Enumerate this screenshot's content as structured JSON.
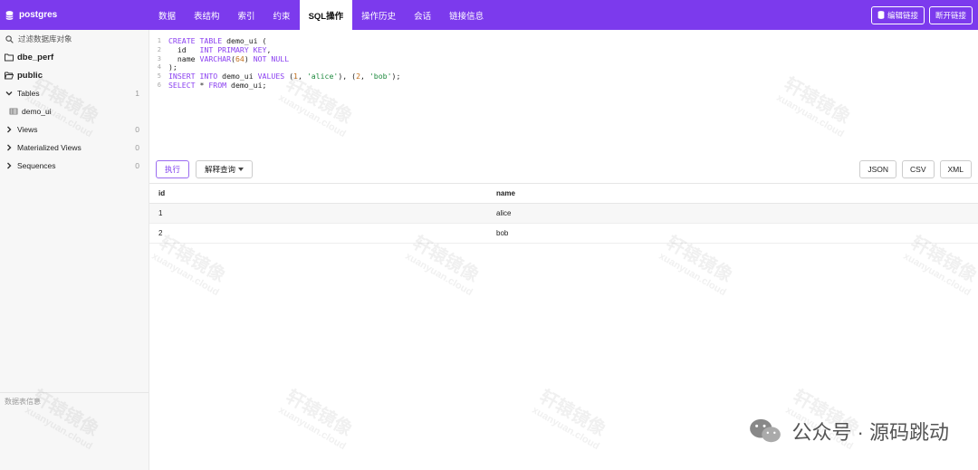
{
  "header": {
    "db_name": "postgres",
    "tabs": [
      "数据",
      "表结构",
      "索引",
      "约束",
      "SQL操作",
      "操作历史",
      "会话",
      "链接信息"
    ],
    "active_tab": "SQL操作",
    "edit_conn_label": "编辑链接",
    "disconnect_label": "断开链接"
  },
  "sidebar": {
    "search_placeholder": "过滤数据库对象",
    "db": "dbe_perf",
    "schema": "public",
    "tables_label": "Tables",
    "tables_count": "1",
    "table_item": "demo_ui",
    "views_label": "Views",
    "views_count": "0",
    "mviews_label": "Materialized Views",
    "mviews_count": "0",
    "sequences_label": "Sequences",
    "sequences_count": "0",
    "footer": "数据表信息"
  },
  "editor": {
    "line_numbers": [
      "1",
      "2",
      "3",
      "4",
      "5",
      "6"
    ]
  },
  "toolbar": {
    "run_label": "执行",
    "explain_label": "解释查询",
    "json_label": "JSON",
    "csv_label": "CSV",
    "xml_label": "XML"
  },
  "results": {
    "columns": [
      "id",
      "name"
    ],
    "rows": [
      [
        "1",
        "alice"
      ],
      [
        "2",
        "bob"
      ]
    ]
  },
  "watermark": {
    "cn": "轩辕镜像",
    "en": "xuanyuan.cloud",
    "footer_brand": "公众号 · 源码跳动"
  },
  "colors": {
    "accent": "#7c3aed"
  }
}
